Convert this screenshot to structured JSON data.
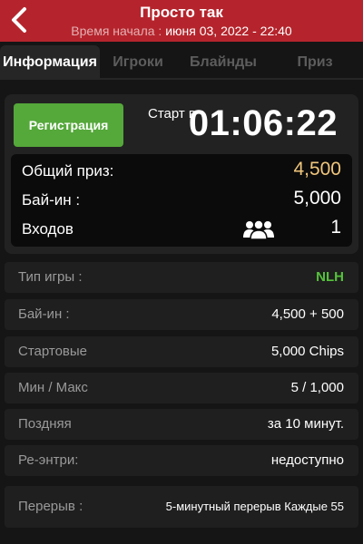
{
  "header": {
    "title": "Просто так",
    "start_label": "Время начала :",
    "start_value": "июня 03, 2022 - 22:40"
  },
  "tabs": [
    {
      "label": "Информация",
      "active": true
    },
    {
      "label": "Игроки",
      "active": false
    },
    {
      "label": "Блайнды",
      "active": false
    },
    {
      "label": "Приз",
      "active": false
    }
  ],
  "panel": {
    "register_label": "Регистрация",
    "start_in_label": "Старт в",
    "countdown": "01:06:22"
  },
  "summary": {
    "prize_label": "Общий приз:",
    "prize_value": "4,500",
    "buyin_label": "Бай-ин :",
    "buyin_value": "5,000",
    "entries_label": "Входов",
    "entries_value": "1",
    "entries_icon": "people-icon"
  },
  "details": [
    {
      "key": "Тип игры :",
      "value": "NLH"
    },
    {
      "key": "Бай-ин :",
      "value": "4,500 + 500"
    },
    {
      "key": "Стартовые",
      "value": "5,000 Chips"
    },
    {
      "key": "Мин / Макс",
      "value": "5 / 1,000"
    },
    {
      "key": "Поздняя",
      "value": "за 10 минут."
    },
    {
      "key": "Ре-энтри:",
      "value": "недоступно"
    },
    {
      "key": "Перерыв :",
      "value": "5-минутный перерыв Каждые 55"
    }
  ],
  "colors": {
    "header_bg": "#b5242c",
    "register_btn": "#55a83a",
    "prize_accent": "#f0c67c",
    "game_type_accent": "#55c23c"
  }
}
